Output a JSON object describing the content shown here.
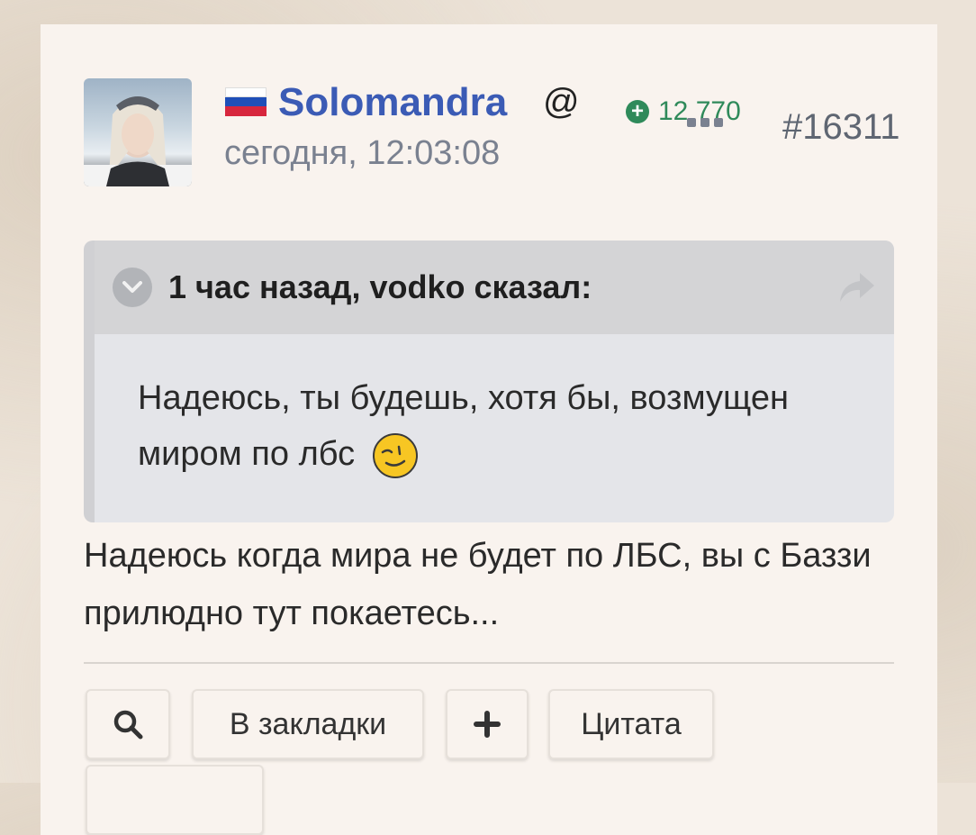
{
  "post": {
    "username": "Solomandra",
    "date": "сегодня, 12:03:08",
    "reputation": "12 770",
    "post_number": "#16311"
  },
  "quote": {
    "header": "1 час назад, vodko сказал:",
    "body": "Надеюсь, ты будешь, хотя бы, возмущен миром по лбс"
  },
  "reply": {
    "text": "Надеюсь когда мира не будет по ЛБС, вы с Баззи прилюдно тут покаетесь..."
  },
  "actions": {
    "bookmark_label": "В закладки",
    "quote_label": "Цитата"
  },
  "colors": {
    "username": "#3b5bb5",
    "reputation": "#2f8a5a"
  },
  "icons": [
    "flag-russia-icon",
    "at-icon",
    "reputation-plus-icon",
    "more-dots-icon",
    "chevron-down-icon",
    "share-arrow-icon",
    "smirk-emoji-icon",
    "search-icon",
    "plus-icon"
  ]
}
